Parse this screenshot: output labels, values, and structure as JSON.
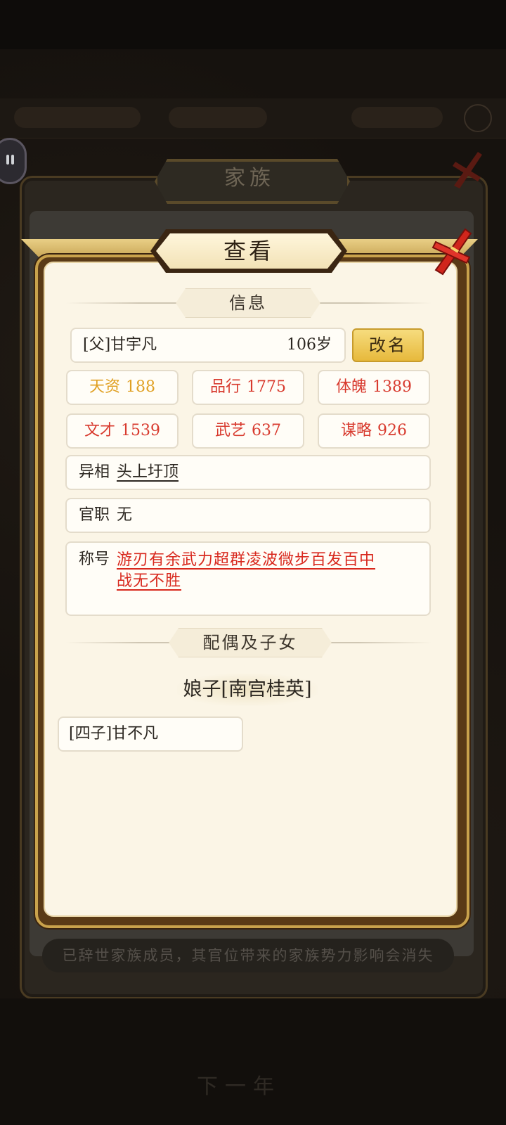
{
  "background": {
    "panel_title": "家族",
    "notice": "已辞世家族成员，其官位带来的家族势力影响会消失",
    "nav_hint": "下一年"
  },
  "dialog": {
    "title": "查看",
    "info_section": "信息",
    "person": {
      "relation_name": "[父]甘宇凡",
      "age": "106岁",
      "rename_label": "改名"
    },
    "stats": [
      {
        "label": "天资",
        "value": "188",
        "color": "#e0a023"
      },
      {
        "label": "品行",
        "value": "1775",
        "color": "#d83a2e"
      },
      {
        "label": "体魄",
        "value": "1389",
        "color": "#d83a2e"
      },
      {
        "label": "文才",
        "value": "1539",
        "color": "#d83a2e"
      },
      {
        "label": "武艺",
        "value": "637",
        "color": "#d83a2e"
      },
      {
        "label": "谋略",
        "value": "926",
        "color": "#d83a2e"
      }
    ],
    "trait": {
      "label": "异相",
      "value": "头上圩顶"
    },
    "office": {
      "label": "官职",
      "value": "无"
    },
    "titles": {
      "label": "称号",
      "line1": "游刃有余武力超群凌波微步百发百中",
      "line2": "战无不胜"
    },
    "family_section": "配偶及子女",
    "spouse": "娘子[南宫桂英]",
    "children": [
      "[四子]甘不凡"
    ]
  }
}
